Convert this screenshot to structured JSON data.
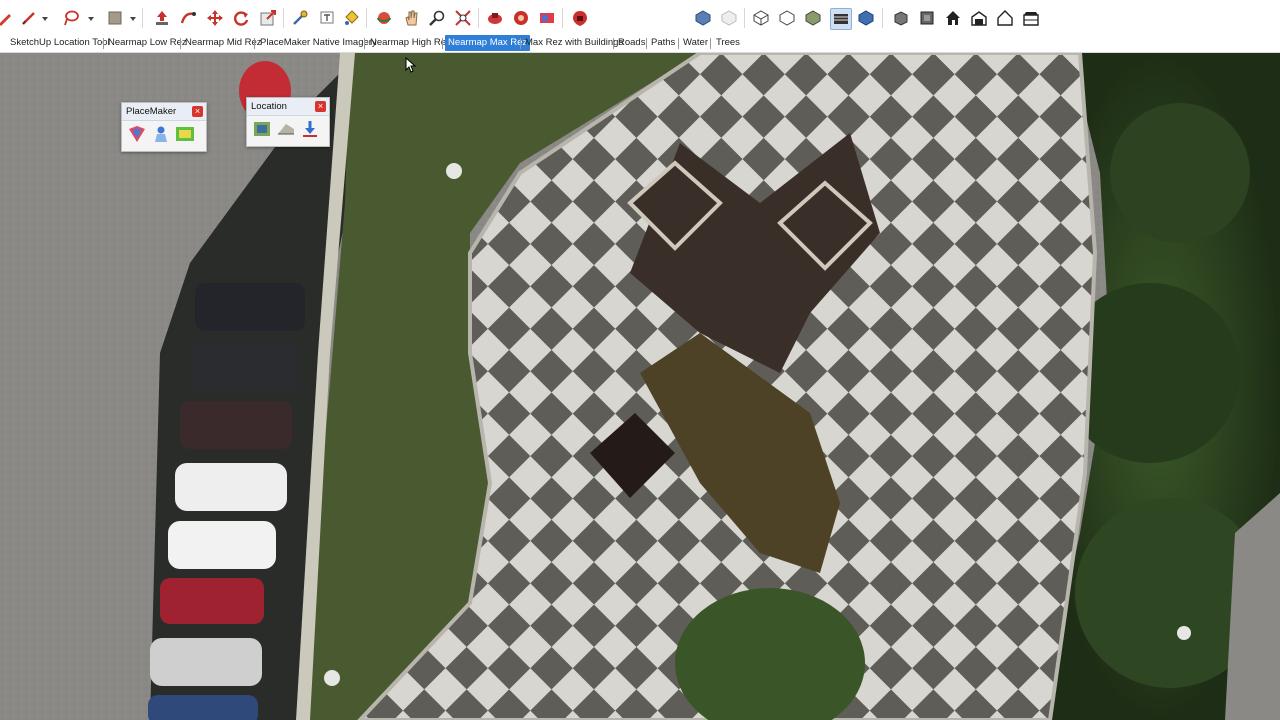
{
  "toolbar": {
    "icons": [
      "pencil-icon",
      "dropdown-arrow-icon",
      "lasso-icon",
      "dropdown-arrow-icon",
      "texture-icon",
      "dropdown-arrow-icon",
      "push-pull-icon",
      "follow-me-icon",
      "move-icon",
      "rotate-icon",
      "scale-icon",
      "tape-measure-icon",
      "text-icon",
      "paint-bucket-icon",
      "orbit-icon",
      "pan-icon",
      "zoom-icon",
      "zoom-extents-icon",
      "placemaker-icon",
      "placemaker-2-icon",
      "placemaker-3-icon",
      "warehouse-icon",
      "section-icon",
      "xray-icon",
      "wireframe-icon",
      "hidden-line-icon",
      "shaded-icon",
      "textured-icon",
      "monochrome-icon",
      "iso-icon",
      "top-view-icon",
      "home-icon",
      "front-view-icon",
      "right-view-icon",
      "back-view-icon",
      "left-view-icon"
    ]
  },
  "tabs": [
    {
      "label": "SketchUp Location Tool",
      "active": false
    },
    {
      "label": "Nearmap Low Rez",
      "active": false
    },
    {
      "label": "Nearmap Mid Rez",
      "active": false
    },
    {
      "label": "PlaceMaker Native Imagery",
      "active": false
    },
    {
      "label": "Nearmap High Rez",
      "active": false
    },
    {
      "label": "Nearmap Max Rez",
      "active": true
    },
    {
      "label": "Max Rez with Buildings",
      "active": false
    },
    {
      "label": "Roads",
      "active": false
    },
    {
      "label": "Paths",
      "active": false
    },
    {
      "label": "Water",
      "active": false
    },
    {
      "label": "Trees",
      "active": false
    }
  ],
  "placemaker_palette": {
    "title": "PlaceMaker",
    "close": "×",
    "buttons": [
      "placemaker-map-icon",
      "placemaker-person-icon",
      "placemaker-dsm-icon"
    ]
  },
  "location_palette": {
    "title": "Location",
    "close": "×",
    "buttons": [
      "add-location-icon",
      "toggle-terrain-icon",
      "import-icon"
    ]
  },
  "colors": {
    "active_tab": "#2f7fd8",
    "close_button": "#d9332e",
    "paving_light": "#d8d6d0",
    "paving_dark": "#5f5d58",
    "grass": "#4a5a30",
    "asphalt": "#8a8985"
  }
}
